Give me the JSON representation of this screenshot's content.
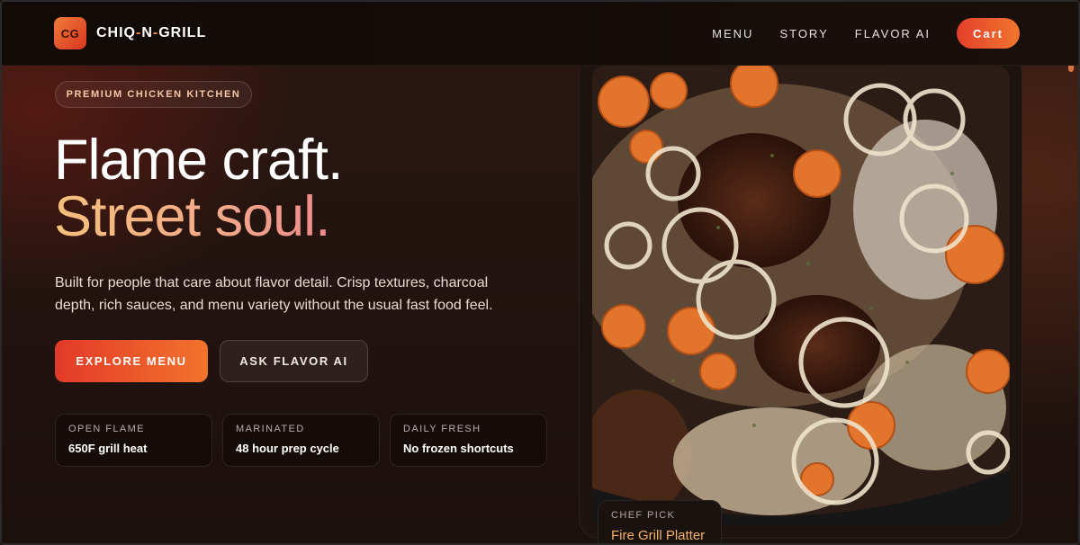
{
  "nav": {
    "logo_initials": "CG",
    "brand": {
      "part1": "CHIQ",
      "dash1": "-",
      "part2": "N",
      "dash2": "-",
      "part3": "GRILL"
    },
    "links": [
      "MENU",
      "STORY",
      "FLAVOR AI"
    ],
    "cart_label": "Cart"
  },
  "hero": {
    "pill": "PREMIUM CHICKEN KITCHEN",
    "headline_line1": "Flame craft.",
    "headline_line2": "Street soul.",
    "lede": "Built for people that care about flavor detail. Crisp textures, charcoal depth, rich sauces, and menu variety without the usual fast food feel.",
    "primary_cta": "EXPLORE MENU",
    "secondary_cta": "ASK FLAVOR AI",
    "stats": [
      {
        "label": "OPEN FLAME",
        "value": "650F grill heat"
      },
      {
        "label": "MARINATED",
        "value": "48 hour prep cycle"
      },
      {
        "label": "DAILY FRESH",
        "value": "No frozen shortcuts"
      }
    ]
  },
  "feature": {
    "tag_label": "CHEF PICK",
    "tag_title": "Fire Grill Platter"
  },
  "colors": {
    "accent_start": "#e23a28",
    "accent_end": "#f3732c",
    "headline_gradient": [
      "#f6c07a",
      "#ee8a8a"
    ],
    "chef_title": "#f3b26a"
  },
  "icons": {
    "logo": "cg-logo-badge",
    "photo": "grilled-chicken-platter-photo"
  }
}
